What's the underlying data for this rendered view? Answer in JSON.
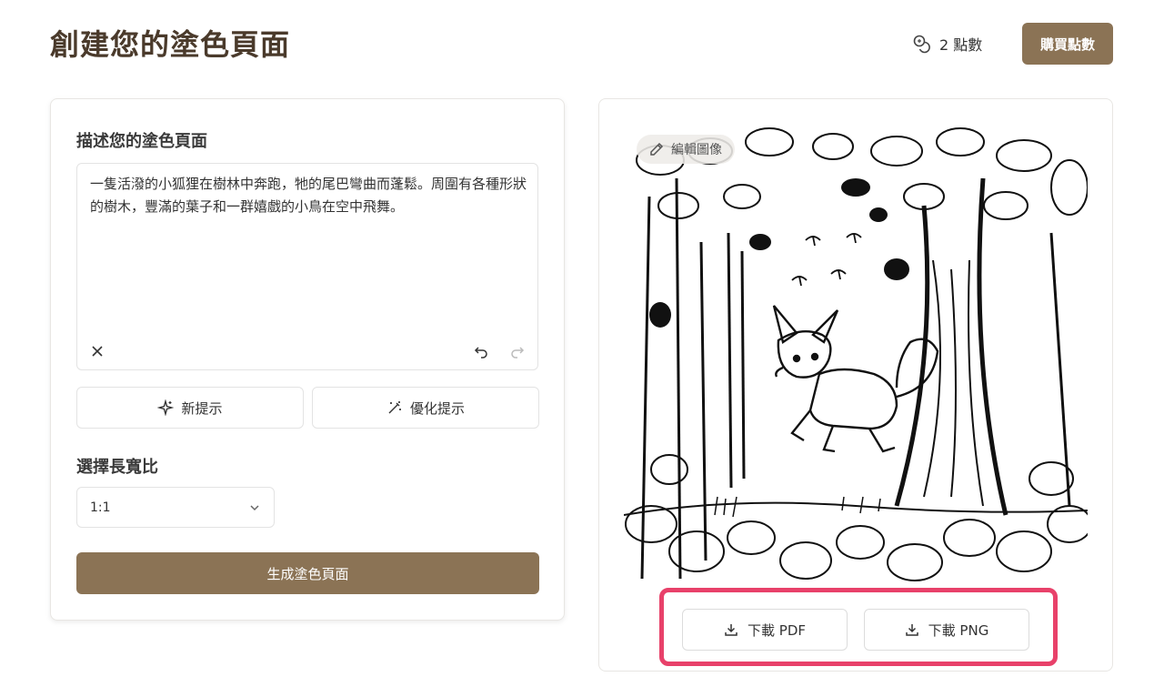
{
  "header": {
    "title": "創建您的塗色頁面",
    "credits": "2 點數",
    "buy_label": "購買點數"
  },
  "form": {
    "prompt_label": "描述您的塗色頁面",
    "prompt_text": "一隻活潑的小狐狸在樹林中奔跑，牠的尾巴彎曲而蓬鬆。周圍有各種形狀的樹木，豐滿的葉子和一群嬉戲的小鳥在空中飛舞。",
    "new_prompt_label": "新提示",
    "optimize_prompt_label": "優化提示",
    "aspect_label": "選擇長寬比",
    "aspect_value": "1:1",
    "generate_label": "生成塗色頁面"
  },
  "preview": {
    "edit_label": "編輯圖像",
    "download_pdf": "下載 PDF",
    "download_png": "下載 PNG"
  },
  "colors": {
    "accent": "#8b7355",
    "highlight": "#e8416a"
  }
}
